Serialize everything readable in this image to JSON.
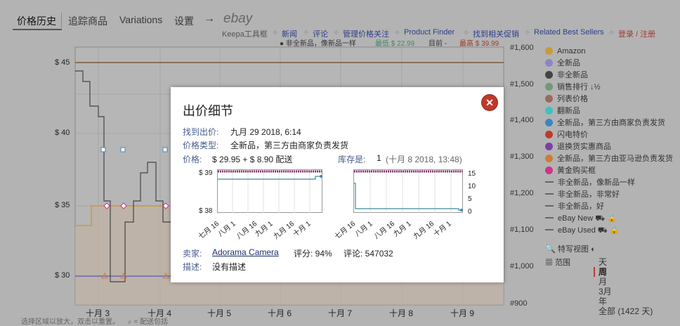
{
  "nav": {
    "tabs": [
      {
        "label": "价格历史",
        "active": true
      },
      {
        "label": "追踪商品"
      },
      {
        "label": "Variations"
      },
      {
        "label": "设置"
      }
    ],
    "arrow": "→",
    "ebay_logo": "ebay",
    "tools": {
      "keepa": "Keepa工具框",
      "news": "新闻",
      "comments": "评论",
      "manage": "管理价格关注",
      "finder": "Product Finder",
      "deals": "找到相关促销",
      "best_sellers": "Related Best Sellers",
      "login": "登录 / 注册"
    }
  },
  "top_legend": {
    "series": "● 非全新品，像新品一样",
    "low": "最低 $ 22.99",
    "current": "目前 -",
    "high": "最高 $ 39.99"
  },
  "chart": {
    "y_left": [
      "$ 45",
      "$ 40",
      "$ 35",
      "$ 30"
    ],
    "y_right": [
      "#1,600",
      "#1,500",
      "#1,400",
      "#1,300",
      "#1,200",
      "#1,100",
      "#1,000",
      "#900"
    ],
    "x_labels": [
      "十月 3",
      "十月 4",
      "十月 5",
      "十月 6",
      "十月 7",
      "十月 8",
      "十月 9"
    ]
  },
  "legend": {
    "items": [
      {
        "label": "Amazon",
        "color": "#c99a3a",
        "kind": "dot"
      },
      {
        "label": "全新品",
        "color": "#8a86c9",
        "kind": "dot"
      },
      {
        "label": "非全新品",
        "color": "#444444",
        "kind": "dot"
      },
      {
        "label": "销售排行 ↓½",
        "color": "#6f9a75",
        "kind": "dot"
      },
      {
        "label": "列表价格",
        "color": "#9a6a5a",
        "kind": "dot"
      },
      {
        "label": "翻新品",
        "color": "#3fc1c1",
        "kind": "dot"
      },
      {
        "label": "全新品，第三方由商家负责发货",
        "color": "#3a86c2",
        "kind": "dot"
      },
      {
        "label": "闪电特价",
        "color": "#c0392b",
        "kind": "dot"
      },
      {
        "label": "退换货实惠商品",
        "color": "#7a3fa5",
        "kind": "dot"
      },
      {
        "label": "全新品，第三方由亚马逊负责发货",
        "color": "#d07a3a",
        "kind": "dot"
      },
      {
        "label": "黄金购买框",
        "color": "#d0338a",
        "kind": "dot"
      },
      {
        "label": "非全新品，像新品一样",
        "kind": "dash"
      },
      {
        "label": "非全新品，非常好",
        "kind": "dash"
      },
      {
        "label": "非全新品，好",
        "kind": "dash"
      },
      {
        "label": "eBay New ⛟ 🔒",
        "kind": "dash"
      },
      {
        "label": "eBay Used ⛟ 🔒",
        "kind": "dash"
      }
    ],
    "close_up": "特写视图",
    "range_label": "范围",
    "ranges": [
      "天",
      "周",
      "月",
      "3月",
      "年",
      "全部 (1422 天)"
    ]
  },
  "modal": {
    "title": "出价细节",
    "found_label": "找到出价:",
    "found_value": "九月 29 2018, 6:14",
    "type_label": "价格类型:",
    "type_value": "全新品，第三方由商家负责发货",
    "price_label": "价格:",
    "price_value": "$ 29.95 + $ 8.90 配送",
    "stock_label": "库存是:",
    "stock_value": "1",
    "stock_time": "(十月 8 2018, 13:48)",
    "seller_label": "卖家:",
    "seller_name": "Adorama Camera",
    "rating": "评分: 94%",
    "reviews": "评论: 547032",
    "desc_label": "描述:",
    "desc_value": "没有描述",
    "price_chart": {
      "y_top": "$ 39",
      "y_bottom": "$ 38",
      "x_labels": [
        "七月 16",
        "八月 1",
        "八月 16",
        "九月 1",
        "九月 16",
        "十月 1"
      ]
    },
    "stock_chart": {
      "y_labels": [
        "15",
        "10",
        "5",
        "0"
      ],
      "x_labels": [
        "七月 16",
        "八月 1",
        "八月 16",
        "九月 1",
        "九月 16",
        "十月 1"
      ]
    }
  },
  "footer": {
    "hint_left": "选择区域以放大，双击以重置。",
    "hint_right": "⌕ = 配送包括"
  }
}
